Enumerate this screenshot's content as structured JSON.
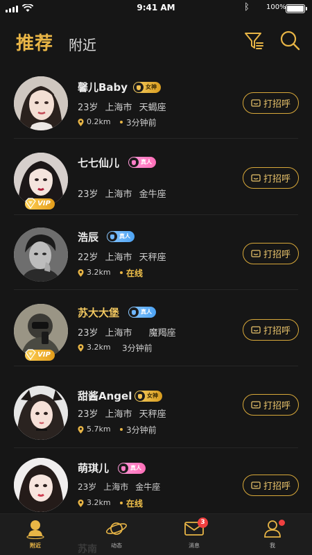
{
  "status": {
    "time": "9:41 AM",
    "battery": "100%"
  },
  "header": {
    "tab_recommend": "推荐",
    "tab_nearby": "附近",
    "filter_icon": "filter-icon",
    "search_icon": "search-icon"
  },
  "greet_label": "打招呼",
  "users": [
    {
      "name": "馨儿Baby",
      "badge": "女神",
      "badge_type": "goddess",
      "vip": false,
      "age": "23岁",
      "city": "上海市",
      "sign": "天蝎座",
      "distance": "0.2km",
      "ago": "3分钟前",
      "online": false
    },
    {
      "name": "七七仙儿",
      "badge": "真人",
      "badge_type": "real-pink",
      "vip": true,
      "age": "23岁",
      "city": "上海市",
      "sign": "金牛座",
      "distance": "",
      "ago": "",
      "online": false
    },
    {
      "name": "浩辰",
      "badge": "真人",
      "badge_type": "real-blue",
      "vip": false,
      "age": "22岁",
      "city": "上海市",
      "sign": "天秤座",
      "distance": "3.2km",
      "ago": "在线",
      "online": true
    },
    {
      "name": "苏大大堡",
      "badge": "真人",
      "badge_type": "real-blue",
      "vip": true,
      "age": "23岁",
      "city": "上海市",
      "sign": "魔羯座",
      "distance": "3.2km",
      "ago": "3分钟前",
      "online": false
    },
    {
      "name": "甜酱Angel",
      "badge": "女神",
      "badge_type": "goddess",
      "vip": false,
      "age": "23岁",
      "city": "上海市",
      "sign": "天秤座",
      "distance": "5.7km",
      "ago": "3分钟前",
      "online": false
    },
    {
      "name": "萌琪儿",
      "badge": "真人",
      "badge_type": "real-pink",
      "vip": false,
      "age": "23岁",
      "city": "上海市",
      "sign": "金牛座",
      "distance": "3.2km",
      "ago": "在线",
      "online": true
    }
  ],
  "vip_label": "VIP",
  "peek_name": "苏南",
  "tabbar": [
    {
      "label": "附近",
      "icon": "nearby-person-icon",
      "active": true
    },
    {
      "label": "动态",
      "icon": "planet-icon",
      "active": false
    },
    {
      "label": "消息",
      "icon": "mail-icon",
      "active": false,
      "badge": "3"
    },
    {
      "label": "我",
      "icon": "profile-icon",
      "active": false,
      "dot": true
    }
  ],
  "colors": {
    "accent": "#e8b546",
    "background": "#161616"
  }
}
